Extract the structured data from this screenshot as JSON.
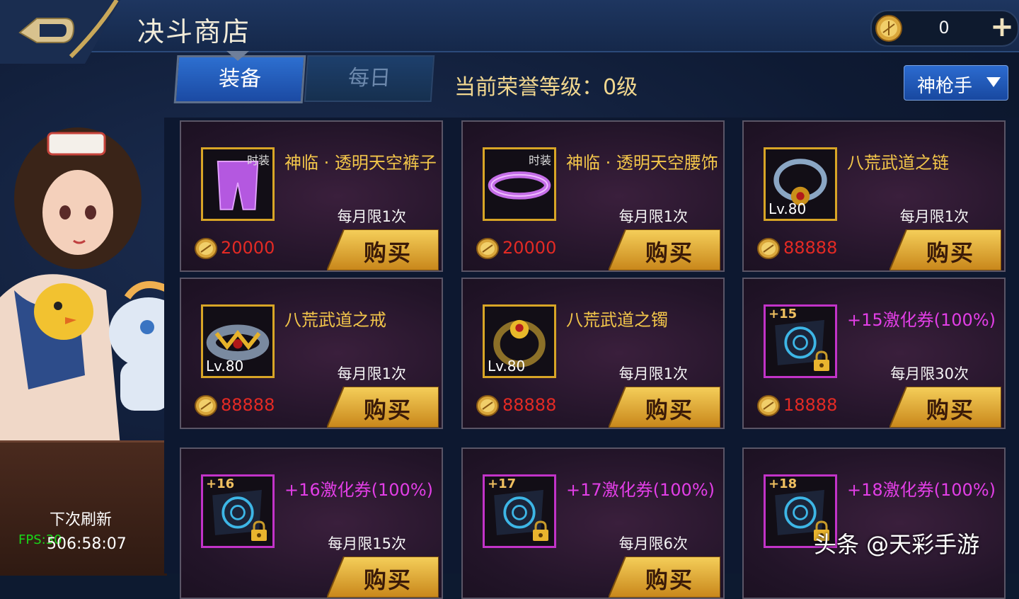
{
  "header": {
    "title": "决斗商店",
    "coin_value": "0",
    "plus_label": "+"
  },
  "tabs": [
    {
      "label": "装备"
    },
    {
      "label": "每日"
    }
  ],
  "honor_label": "当前荣誉等级：0级",
  "class_select": {
    "selected": "神枪手"
  },
  "refresh": {
    "label": "下次刷新",
    "time": "506:58:07"
  },
  "fps": "FPS:30",
  "buy_label": "购买",
  "items": [
    {
      "name": "神临 · 透明天空裤子",
      "name_color": "#f3c64a",
      "tag": "时装",
      "level": "",
      "plus": "",
      "limit": "每月限1次",
      "price": "20000"
    },
    {
      "name": "神临 · 透明天空腰饰",
      "name_color": "#f3c64a",
      "tag": "时装",
      "level": "",
      "plus": "",
      "limit": "每月限1次",
      "price": "20000"
    },
    {
      "name": "八荒武道之链",
      "name_color": "#f3c64a",
      "tag": "",
      "level": "Lv.80",
      "plus": "",
      "limit": "每月限1次",
      "price": "88888"
    },
    {
      "name": "八荒武道之戒",
      "name_color": "#f3c64a",
      "tag": "",
      "level": "Lv.80",
      "plus": "",
      "limit": "每月限1次",
      "price": "88888"
    },
    {
      "name": "八荒武道之镯",
      "name_color": "#f3c64a",
      "tag": "",
      "level": "Lv.80",
      "plus": "",
      "limit": "每月限1次",
      "price": "88888"
    },
    {
      "name": "+15激化券(100%)",
      "name_color": "#e23ee6",
      "tag": "",
      "level": "",
      "plus": "+15",
      "limit": "每月限30次",
      "price": "18888"
    },
    {
      "name": "+16激化券(100%)",
      "name_color": "#e23ee6",
      "tag": "",
      "level": "",
      "plus": "+16",
      "limit": "每月限15次",
      "price": ""
    },
    {
      "name": "+17激化券(100%)",
      "name_color": "#e23ee6",
      "tag": "",
      "level": "",
      "plus": "+17",
      "limit": "每月限6次",
      "price": ""
    },
    {
      "name": "+18激化券(100%)",
      "name_color": "#e23ee6",
      "tag": "",
      "level": "",
      "plus": "+18",
      "limit": "",
      "price": ""
    }
  ],
  "watermark": "头条 @天彩手游"
}
